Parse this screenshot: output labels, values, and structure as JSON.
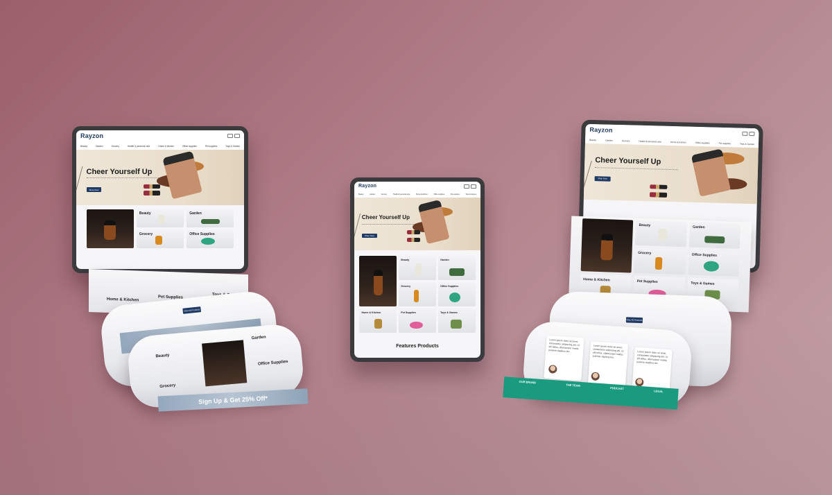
{
  "brand": "Rayzon",
  "nav": [
    "Beauty",
    "Garden",
    "Grocery",
    "Health & personal care",
    "Home & kitchen",
    "Office supplies",
    "Pet supplies",
    "Toys & Games"
  ],
  "hero": {
    "title": "Cheer Yourself Up",
    "button": "Shop Now"
  },
  "categories": [
    "Beauty",
    "Garden",
    "Grocery",
    "Office Supplies",
    "Home & Kitchen",
    "Pet Supplies",
    "Toys & Games"
  ],
  "features_title": "Features Products",
  "signup_banner": "Sign Up & Get 25% Off*",
  "testimonial_text": "Lorem ipsum dolor sit amet, consectetur adipiscing elit. Ut elit tellus, ullamcorper mattis, pulvinar dapibus leo.",
  "footer": [
    "OUR BRAND",
    "THE TEAM",
    "PODCAST",
    "LEGAL"
  ],
  "colors": {
    "brand": "#1f3a64",
    "footer": "#1a9b80",
    "background": "#b1808a"
  }
}
